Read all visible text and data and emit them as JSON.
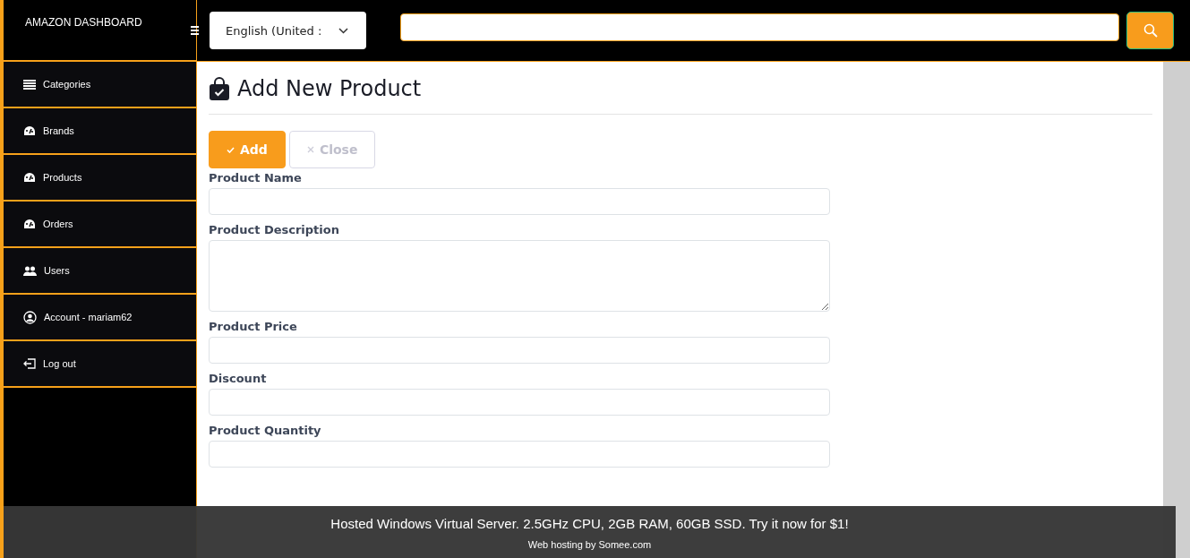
{
  "brand": "AMAZON DASHBOARD",
  "language_select": {
    "value": "English (United :"
  },
  "sidebar": {
    "items": [
      {
        "label": "Categories",
        "kind": "list",
        "selected": false
      },
      {
        "label": "Brands",
        "kind": "gauge",
        "selected": false
      },
      {
        "label": "Products",
        "kind": "gauge",
        "selected": false
      },
      {
        "label": "Orders",
        "kind": "gauge",
        "selected": false
      },
      {
        "label": "Users",
        "kind": "users",
        "selected": false
      },
      {
        "label": "Account - mariam62",
        "kind": "user",
        "selected": false
      },
      {
        "label": "Log out",
        "kind": "logout",
        "selected": false
      }
    ]
  },
  "page": {
    "title": "Add New Product"
  },
  "buttons": [
    {
      "label": "Add",
      "kind": "primary",
      "disabled": false
    },
    {
      "label": "Close",
      "kind": "secondary",
      "disabled": true
    }
  ],
  "fields": [
    {
      "label": "Product Name",
      "kind": "input"
    },
    {
      "label": "Product Description",
      "kind": "textarea"
    },
    {
      "label": "Product Price",
      "kind": "input"
    },
    {
      "label": "Discount",
      "kind": "input"
    },
    {
      "label": "Product Quantity",
      "kind": "input"
    }
  ],
  "banner": {
    "text": "Hosted Windows Virtual Server. 2.5GHz CPU, 2GB RAM, 60GB SSD. Try it now for $1!",
    "subtext": "Web hosting by Somee.com"
  }
}
